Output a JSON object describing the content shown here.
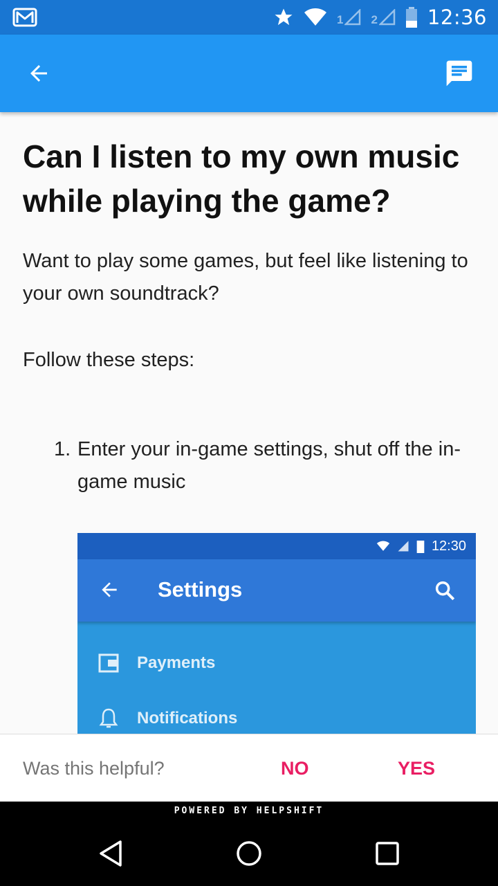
{
  "status_bar": {
    "time": "12:36",
    "sim1": "1",
    "sim2": "2",
    "icons": [
      "gmail-icon",
      "star-icon",
      "wifi-icon",
      "signal-icon",
      "battery-icon"
    ]
  },
  "app_bar": {
    "back_icon": "arrow-back-icon",
    "chat_icon": "chat-icon",
    "color": "#2196f3"
  },
  "article": {
    "title": "Can I listen to my own music while playing the game?",
    "paragraphs": [
      "Want to play some games, but feel like listening to your own soundtrack?",
      "Follow these steps:"
    ],
    "steps": [
      {
        "number": "1.",
        "text": "Enter your in-game settings, shut off the in-game music"
      }
    ],
    "screenshot": {
      "time": "12:30",
      "title": "Settings",
      "items": [
        "Payments",
        "Notifications"
      ]
    }
  },
  "feedback": {
    "question": "Was this helpful?",
    "no_label": "NO",
    "yes_label": "YES",
    "accent": "#e91e63"
  },
  "powered_by": "POWERED BY HELPSHIFT"
}
